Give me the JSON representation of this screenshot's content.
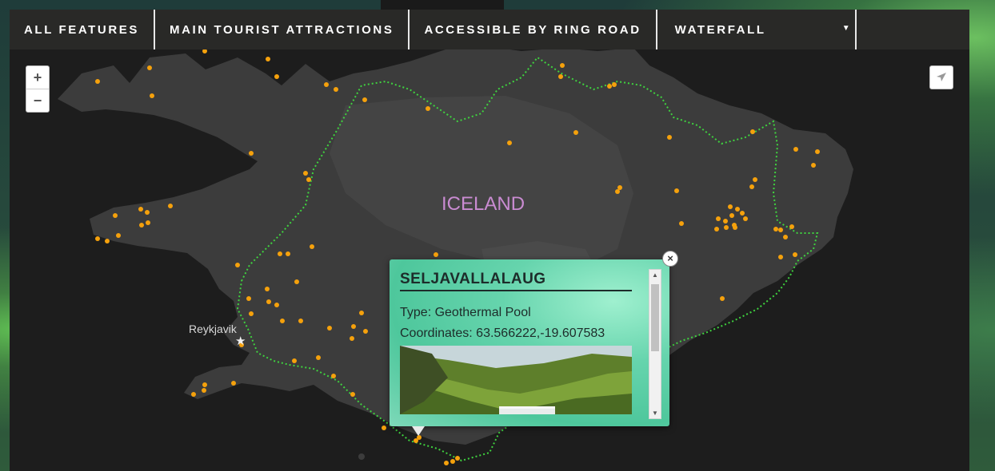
{
  "nav": {
    "items": [
      {
        "label": "ALL FEATURES"
      },
      {
        "label": "MAIN TOURIST ATTRACTIONS"
      },
      {
        "label": "ACCESSIBLE BY RING ROAD"
      }
    ],
    "filter_select": {
      "value": "WATERFALL",
      "caret": "▼"
    }
  },
  "zoom": {
    "in": "+",
    "out": "−"
  },
  "map": {
    "country_label": "ICELAND",
    "city_label": "Reykjavik",
    "city_marker": "★",
    "colors": {
      "land": "#3c3c3c",
      "sea": "#1d1d1d",
      "ring_road": "#3fd23f",
      "poi": "#f5a10c"
    }
  },
  "popup": {
    "title": "SELJAVALLALAUG",
    "type_line": "Type: Geothermal Pool",
    "coords_line": "Coordinates: 63.566222,-19.607583",
    "close": "×",
    "scroll_up": "▲",
    "scroll_down": "▼"
  },
  "icons": {
    "locate": "paper-plane-icon",
    "close": "close-icon"
  }
}
